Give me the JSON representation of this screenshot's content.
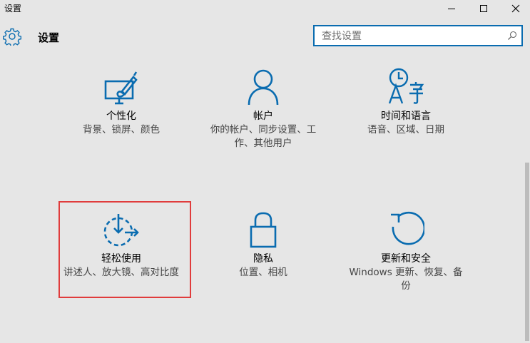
{
  "window": {
    "title": "设置",
    "minimize_icon": "minimize-icon",
    "maximize_icon": "maximize-icon",
    "close_icon": "close-icon"
  },
  "header": {
    "icon": "gear-icon",
    "title": "设置"
  },
  "search": {
    "placeholder": "查找设置",
    "value": "",
    "icon": "search-icon"
  },
  "accent_color": "#0a6cb0",
  "highlight_color": "#e03c3c",
  "tiles": [
    {
      "title": "个性化",
      "desc": "背景、锁屏、颜色",
      "icon": "personalization-icon"
    },
    {
      "title": "帐户",
      "desc": "你的帐户、同步设置、工作、其他用户",
      "icon": "account-icon"
    },
    {
      "title": "时间和语言",
      "desc": "语音、区域、日期",
      "icon": "time-language-icon"
    },
    {
      "title": "轻松使用",
      "desc": "讲述人、放大镜、高对比度",
      "icon": "ease-of-access-icon",
      "highlighted": true
    },
    {
      "title": "隐私",
      "desc": "位置、相机",
      "icon": "privacy-lock-icon"
    },
    {
      "title": "更新和安全",
      "desc": "Windows 更新、恢复、备份",
      "icon": "update-security-icon"
    }
  ]
}
